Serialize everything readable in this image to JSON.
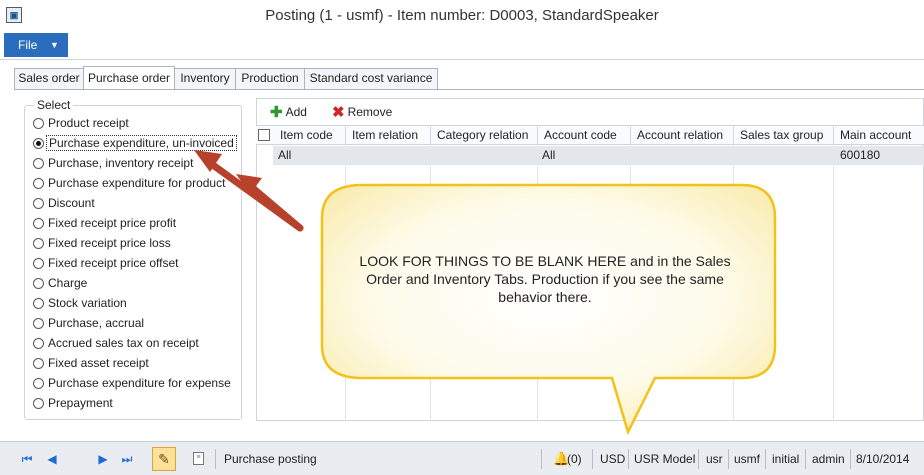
{
  "window": {
    "title": "Posting (1 - usmf) - Item number: D0003, StandardSpeaker",
    "app_icon": "ax-icon"
  },
  "ribbon": {
    "file_label": "File",
    "file_caret": "▼"
  },
  "tabs": [
    {
      "label": "Sales order"
    },
    {
      "label": "Purchase order",
      "active": true
    },
    {
      "label": "Inventory"
    },
    {
      "label": "Production"
    },
    {
      "label": "Standard cost variance"
    }
  ],
  "select": {
    "legend": "Select",
    "options": [
      {
        "label": "Product receipt"
      },
      {
        "label": "Purchase expenditure, un-invoiced",
        "checked": true
      },
      {
        "label": "Purchase, inventory receipt"
      },
      {
        "label": "Purchase expenditure for product"
      },
      {
        "label": "Discount"
      },
      {
        "label": "Fixed receipt price profit"
      },
      {
        "label": "Fixed receipt price loss"
      },
      {
        "label": "Fixed receipt price offset"
      },
      {
        "label": "Charge"
      },
      {
        "label": "Stock variation"
      },
      {
        "label": "Purchase, accrual"
      },
      {
        "label": "Accrued sales tax on receipt"
      },
      {
        "label": "Fixed asset receipt"
      },
      {
        "label": "Purchase expenditure for expense"
      },
      {
        "label": "Prepayment"
      }
    ]
  },
  "toolbar": {
    "add_label": "Add",
    "remove_label": "Remove"
  },
  "grid": {
    "columns": [
      "Item code",
      "Item relation",
      "Category relation",
      "Account code",
      "Account relation",
      "Sales tax group",
      "Main account"
    ],
    "rows": [
      [
        "All",
        "",
        "",
        "All",
        "",
        "",
        "600180"
      ]
    ]
  },
  "callout": {
    "text": "LOOK FOR THINGS TO BE BLANK HERE and in the Sales Order and Inventory Tabs.  Production if you see the same behavior there.",
    "fill_color": "#fdf6c8",
    "border_color": "#f2c21b",
    "arrow_color": "#c0392b"
  },
  "statusbar": {
    "posting_label": "Purchase posting",
    "notifications": "(0)",
    "currency": "USD",
    "model": "USR Model",
    "user_code": "usr",
    "company": "usmf",
    "partition": "initial",
    "user": "admin",
    "date": "8/10/2014"
  }
}
